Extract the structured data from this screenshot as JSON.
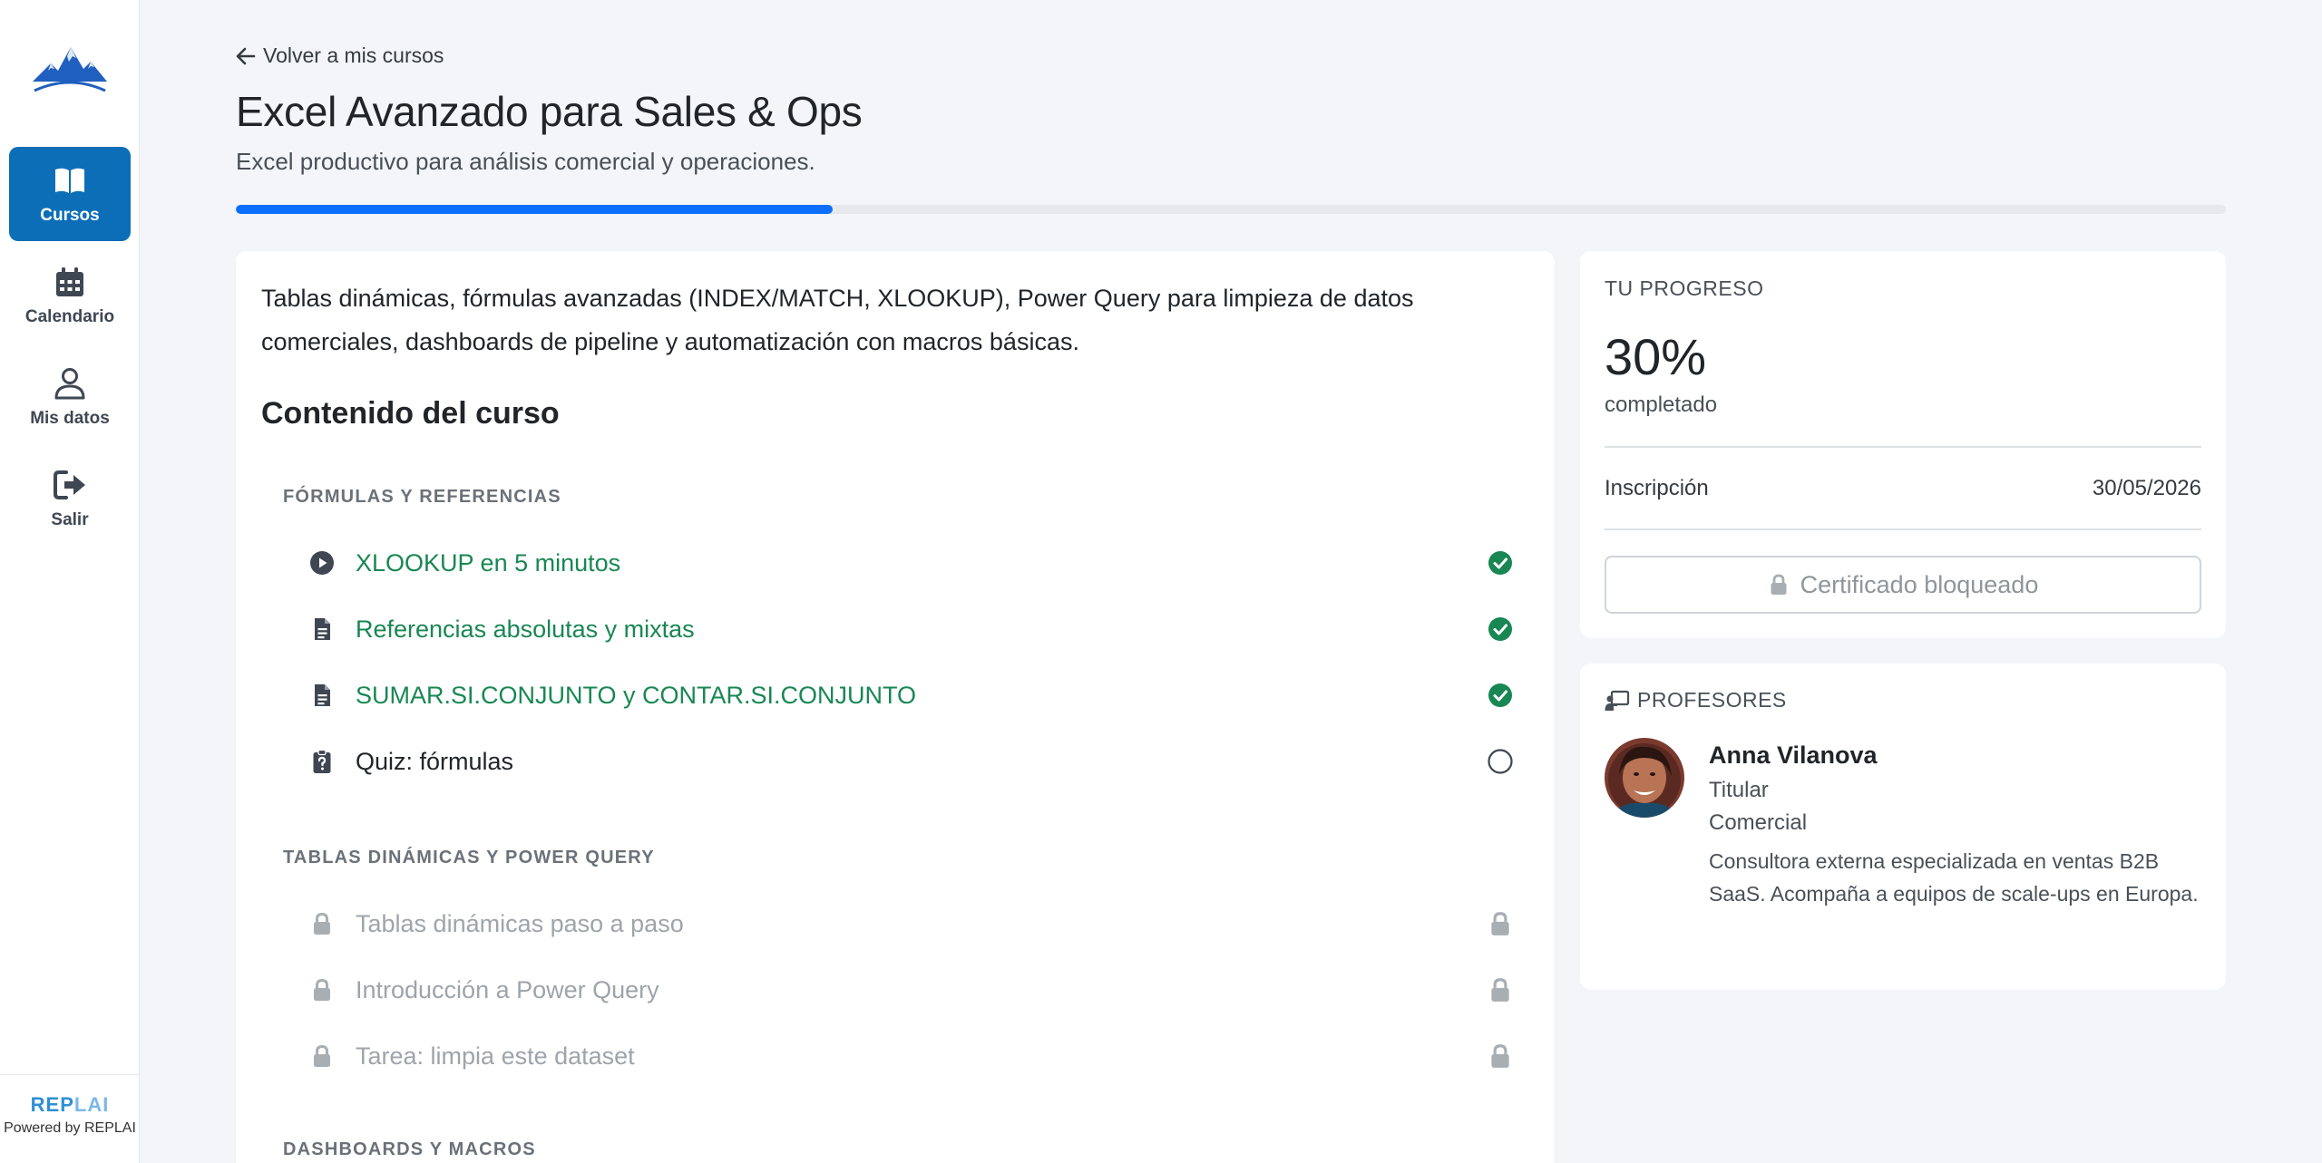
{
  "sidebar": {
    "items": [
      {
        "label": "Cursos",
        "icon": "book-open-icon",
        "active": true
      },
      {
        "label": "Calendario",
        "icon": "calendar-icon"
      },
      {
        "label": "Mis datos",
        "icon": "user-icon"
      },
      {
        "label": "Salir",
        "icon": "sign-out-icon"
      }
    ],
    "brand_name_a": "REP",
    "brand_name_b": "LAI",
    "brand_sub": "Powered by REPLAI"
  },
  "header": {
    "back_label": "Volver a mis cursos",
    "title": "Excel Avanzado para Sales & Ops",
    "subtitle": "Excel productivo para análisis comercial y operaciones.",
    "progress_fraction": 0.3
  },
  "course": {
    "description": "Tablas dinámicas, fórmulas avanzadas (INDEX/MATCH, XLOOKUP), Power Query para limpieza de datos comerciales, dashboards de pipeline y automatización con macros básicas.",
    "content_title": "Contenido del curso",
    "modules": [
      {
        "title": "FÓRMULAS Y REFERENCIAS",
        "lessons": [
          {
            "label": "XLOOKUP en 5 minutos",
            "type": "video",
            "status": "completed"
          },
          {
            "label": "Referencias absolutas y mixtas",
            "type": "document",
            "status": "completed"
          },
          {
            "label": "SUMAR.SI.CONJUNTO y CONTAR.SI.CONJUNTO",
            "type": "document",
            "status": "completed"
          },
          {
            "label": "Quiz: fórmulas",
            "type": "quiz",
            "status": "pending"
          }
        ]
      },
      {
        "title": "TABLAS DINÁMICAS Y POWER QUERY",
        "lessons": [
          {
            "label": "Tablas dinámicas paso a paso",
            "type": "locked",
            "status": "locked"
          },
          {
            "label": "Introducción a Power Query",
            "type": "locked",
            "status": "locked"
          },
          {
            "label": "Tarea: limpia este dataset",
            "type": "locked",
            "status": "locked"
          }
        ]
      },
      {
        "title": "DASHBOARDS Y MACROS",
        "lessons": []
      }
    ]
  },
  "progress": {
    "label": "TU PROGRESO",
    "percent": "30%",
    "completed_label": "completado",
    "enrollment_label": "Inscripción",
    "enrollment_date": "30/05/2026",
    "certificate_label": "Certificado bloqueado"
  },
  "teachers": {
    "label": "PROFESORES",
    "list": [
      {
        "name": "Anna Vilanova",
        "role": "Titular",
        "department": "Comercial",
        "bio": "Consultora externa especializada en ventas B2B SaaS. Acompaña a equipos de scale-ups en Europa."
      }
    ]
  },
  "colors": {
    "accent": "#0d6eb8",
    "progress": "#0d6efd",
    "success": "#198754",
    "muted": "#9ea4aa"
  }
}
